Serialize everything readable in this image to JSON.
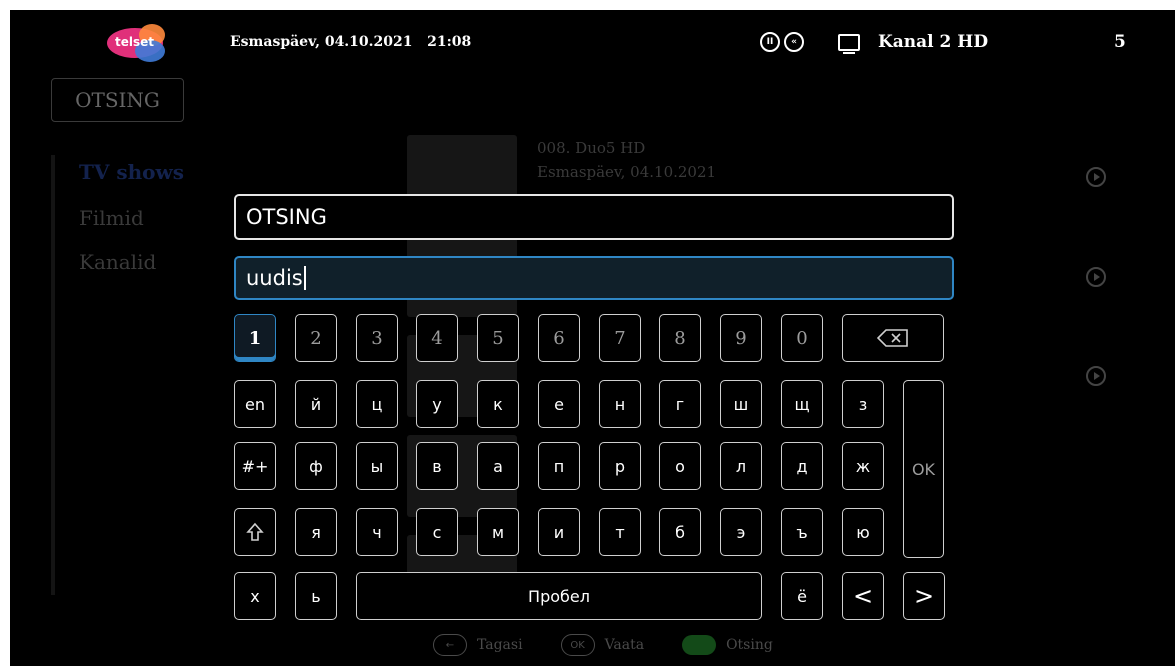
{
  "header": {
    "logo_text": "telset",
    "datetime": "Esmaspäev, 04.10.2021   21:08",
    "channel_name": "Kanal 2 HD",
    "channel_number": "5"
  },
  "sidebar": {
    "search_tab": "OTSING",
    "items": [
      {
        "label": "TV shows",
        "active": true
      },
      {
        "label": "Filmid"
      },
      {
        "label": "Kanalid"
      }
    ]
  },
  "results": [
    {
      "line1": "008. Duo5 HD",
      "line2": "Esmaspäev, 04.10.2021"
    }
  ],
  "search": {
    "title": "OTSING",
    "query": "uudis"
  },
  "keyboard": {
    "digits": [
      "1",
      "2",
      "3",
      "4",
      "5",
      "6",
      "7",
      "8",
      "9",
      "0"
    ],
    "row2": [
      "en",
      "й",
      "ц",
      "у",
      "к",
      "е",
      "н",
      "г",
      "ш",
      "щ",
      "з"
    ],
    "row3": [
      "#+",
      "ф",
      "ы",
      "в",
      "а",
      "п",
      "р",
      "о",
      "л",
      "д",
      "ж"
    ],
    "row4": [
      "я",
      "ч",
      "с",
      "м",
      "и",
      "т",
      "б",
      "э",
      "ъ",
      "ю"
    ],
    "row5_left": [
      "х",
      "ь"
    ],
    "space_label": "Пробел",
    "yo": "ё",
    "ok_label": "OK",
    "left_arrow": "<",
    "right_arrow": ">"
  },
  "hints": {
    "back_label": "Tagasi",
    "ok_badge": "OK",
    "watch_label": "Vaata",
    "search_label": "Otsing"
  },
  "colors": {
    "accent": "#2f86c4",
    "key_border": "#cfcfcf",
    "background": "#000000"
  }
}
